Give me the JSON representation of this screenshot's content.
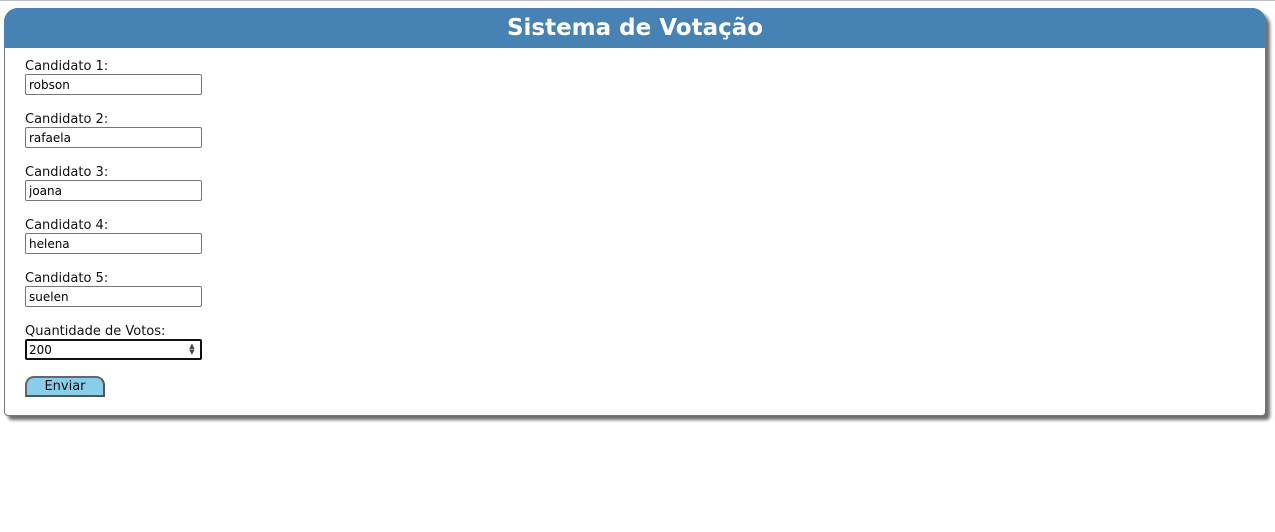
{
  "app": {
    "title": "Sistema de Votação",
    "header_color": "#4682b4",
    "button_color": "#87ceeb"
  },
  "form": {
    "fields": [
      {
        "label": "Candidato 1:",
        "value": "robson"
      },
      {
        "label": "Candidato 2:",
        "value": "rafaela"
      },
      {
        "label": "Candidato 3:",
        "value": "joana"
      },
      {
        "label": "Candidato 4:",
        "value": "helena"
      },
      {
        "label": "Candidato 5:",
        "value": "suelen"
      }
    ],
    "votes": {
      "label": "Quantidade de Votos:",
      "value": "200"
    },
    "submit_label": "Enviar"
  }
}
